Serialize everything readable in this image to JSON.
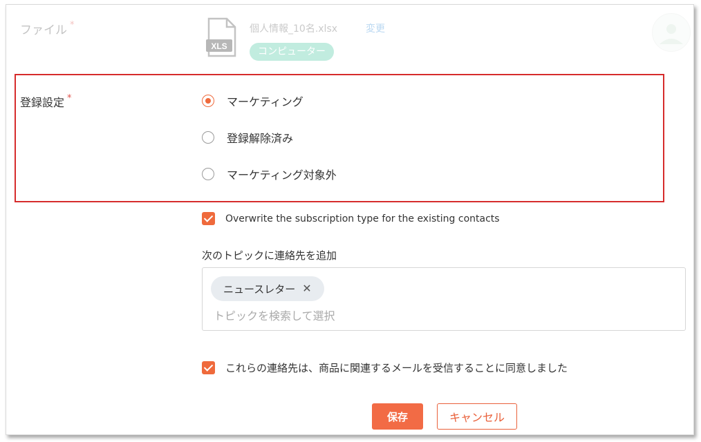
{
  "file": {
    "label": "ファイル",
    "required_mark": "*",
    "file_name": "個人情報_10名.xlsx",
    "change_link": "変更",
    "source_badge": "コンピューター",
    "icon": "xls-file-icon",
    "icon_text": "XLS"
  },
  "subscription": {
    "label": "登録設定",
    "required_mark": "*",
    "options": [
      {
        "label": "マーケティング",
        "checked": true
      },
      {
        "label": "登録解除済み",
        "checked": false
      },
      {
        "label": "マーケティング対象外",
        "checked": false
      }
    ]
  },
  "overwrite": {
    "label": "Overwrite the subscription type for the existing contacts",
    "checked": true
  },
  "topics": {
    "label": "次のトピックに連絡先を追加",
    "chips": [
      {
        "label": "ニュースレター",
        "remove_glyph": "✕"
      }
    ],
    "placeholder": "トピックを検索して選択"
  },
  "consent": {
    "label": "これらの連絡先は、商品に関連するメールを受信することに同意しました",
    "checked": true
  },
  "actions": {
    "save": "保存",
    "cancel": "キャンセル"
  },
  "colors": {
    "accent": "#ef6a3c",
    "highlight_border": "#d62b2b",
    "link": "#3a8fd8",
    "badge": "#4fc9a6"
  }
}
